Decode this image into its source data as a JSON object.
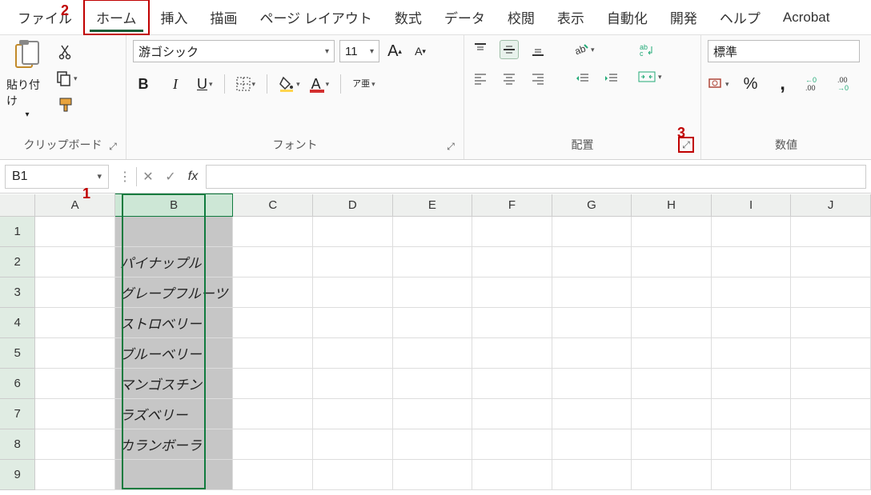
{
  "menu": {
    "items": [
      "ファイル",
      "ホーム",
      "挿入",
      "描画",
      "ページ レイアウト",
      "数式",
      "データ",
      "校閲",
      "表示",
      "自動化",
      "開発",
      "ヘルプ",
      "Acrobat"
    ],
    "active_index": 1
  },
  "annotations": {
    "a1": "1",
    "a2": "2",
    "a3": "3"
  },
  "ribbon": {
    "clipboard": {
      "paste_label": "貼り付け",
      "group_label": "クリップボード"
    },
    "font": {
      "name": "游ゴシック",
      "size": "11",
      "increase": "A",
      "decrease": "A",
      "bold": "B",
      "italic": "I",
      "underline": "U",
      "phonetic": "ア亜",
      "group_label": "フォント"
    },
    "align": {
      "group_label": "配置",
      "wrap_label": "abc"
    },
    "number": {
      "format": "標準",
      "group_label": "数値",
      "percent": "%",
      "comma": "ᐟ",
      "dec_inc": ".0",
      "dec_dec": ".00"
    }
  },
  "formula": {
    "name_box": "B1",
    "fx": "fx",
    "value": ""
  },
  "grid": {
    "cols": [
      "A",
      "B",
      "C",
      "D",
      "E",
      "F",
      "G",
      "H",
      "I",
      "J"
    ],
    "rows": [
      {
        "n": "1",
        "b": ""
      },
      {
        "n": "2",
        "b": "パイナップル"
      },
      {
        "n": "3",
        "b": "グレープフルーツ"
      },
      {
        "n": "4",
        "b": "ストロベリー"
      },
      {
        "n": "5",
        "b": "ブルーベリー"
      },
      {
        "n": "6",
        "b": "マンゴスチン"
      },
      {
        "n": "7",
        "b": "ラズベリー"
      },
      {
        "n": "8",
        "b": "カランボーラ"
      },
      {
        "n": "9",
        "b": ""
      }
    ],
    "selected_col": "B"
  }
}
